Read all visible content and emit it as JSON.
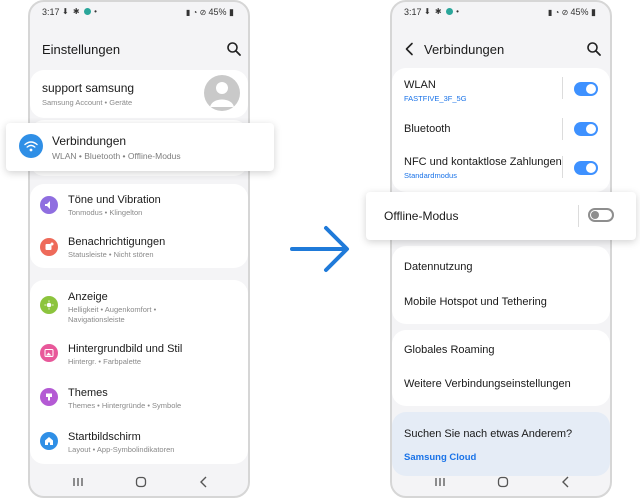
{
  "colors": {
    "accent": "#3e91ff",
    "link": "#1a73e8",
    "arrow": "#1f7ad9"
  },
  "left": {
    "status": {
      "time": "3:17",
      "battery": "45%"
    },
    "title": "Einstellungen",
    "account": {
      "name": "support samsung",
      "subtitle": "Samsung Account  •  Geräte"
    },
    "connections": {
      "title": "Verbindungen",
      "subtitle": "WLAN  •  Bluetooth  •  Offline-Modus"
    },
    "items": [
      {
        "title": "Töne und Vibration",
        "subtitle": "Tonmodus  •  Klingelton",
        "icon": "sound-icon"
      },
      {
        "title": "Benachrichtigungen",
        "subtitle": "Statusleiste  •  Nicht stören",
        "icon": "notifications-icon"
      },
      {
        "title": "Anzeige",
        "subtitle": "Helligkeit  •  Augenkomfort  •  Navigationsleiste",
        "icon": "display-icon"
      },
      {
        "title": "Hintergrundbild und Stil",
        "subtitle": "Hintergr.  •  Farbpalette",
        "icon": "wallpaper-icon"
      },
      {
        "title": "Themes",
        "subtitle": "Themes  •  Hintergründe  •  Symbole",
        "icon": "themes-icon"
      },
      {
        "title": "Startbildschirm",
        "subtitle": "Layout  •  App-Symbolindikatoren",
        "icon": "home-icon"
      }
    ]
  },
  "right": {
    "status": {
      "time": "3:17",
      "battery": "45%"
    },
    "title": "Verbindungen",
    "wlan": {
      "title": "WLAN",
      "network": "FASTFIVE_3F_5G",
      "enabled": true
    },
    "bluetooth": {
      "title": "Bluetooth",
      "enabled": true
    },
    "nfc": {
      "title": "NFC und kontaktlose Zahlungen",
      "subtitle": "Standardmodus",
      "enabled": true
    },
    "offline": {
      "title": "Offline-Modus",
      "enabled": false
    },
    "data_usage": "Datennutzung",
    "hotspot": "Mobile Hotspot und Tethering",
    "roaming": "Globales Roaming",
    "more": "Weitere Verbindungseinstellungen",
    "suggest": {
      "question": "Suchen Sie nach etwas Anderem?",
      "link": "Samsung Cloud"
    }
  }
}
